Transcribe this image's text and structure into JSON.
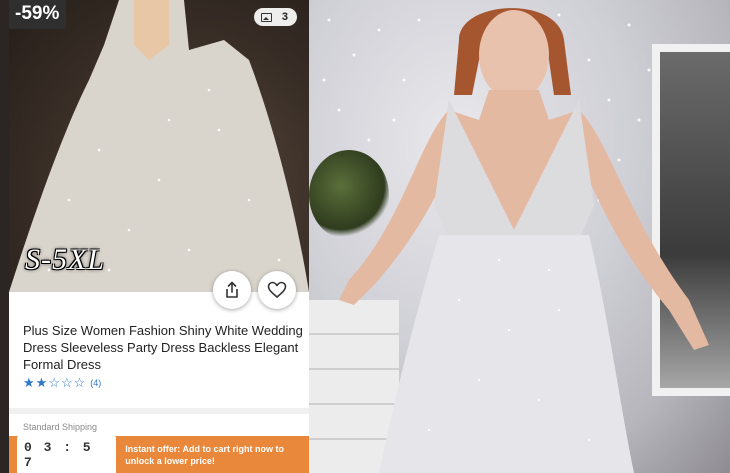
{
  "product": {
    "discount": "-59%",
    "image_count": "3",
    "size_range": "S-5XL",
    "title": "Plus Size Women Fashion Shiny White Wedding Dress Sleeveless Party Dress Backless Elegant Formal Dress",
    "rating": {
      "stars": 2,
      "max": 5,
      "count": "(4)"
    },
    "shipping": "Standard Shipping"
  },
  "offer": {
    "timer": "03:57",
    "text": "Instant offer: Add to cart right now to unlock a lower price!"
  },
  "colors": {
    "accent_orange": "#e9873a",
    "star_blue": "#2e77c9"
  }
}
